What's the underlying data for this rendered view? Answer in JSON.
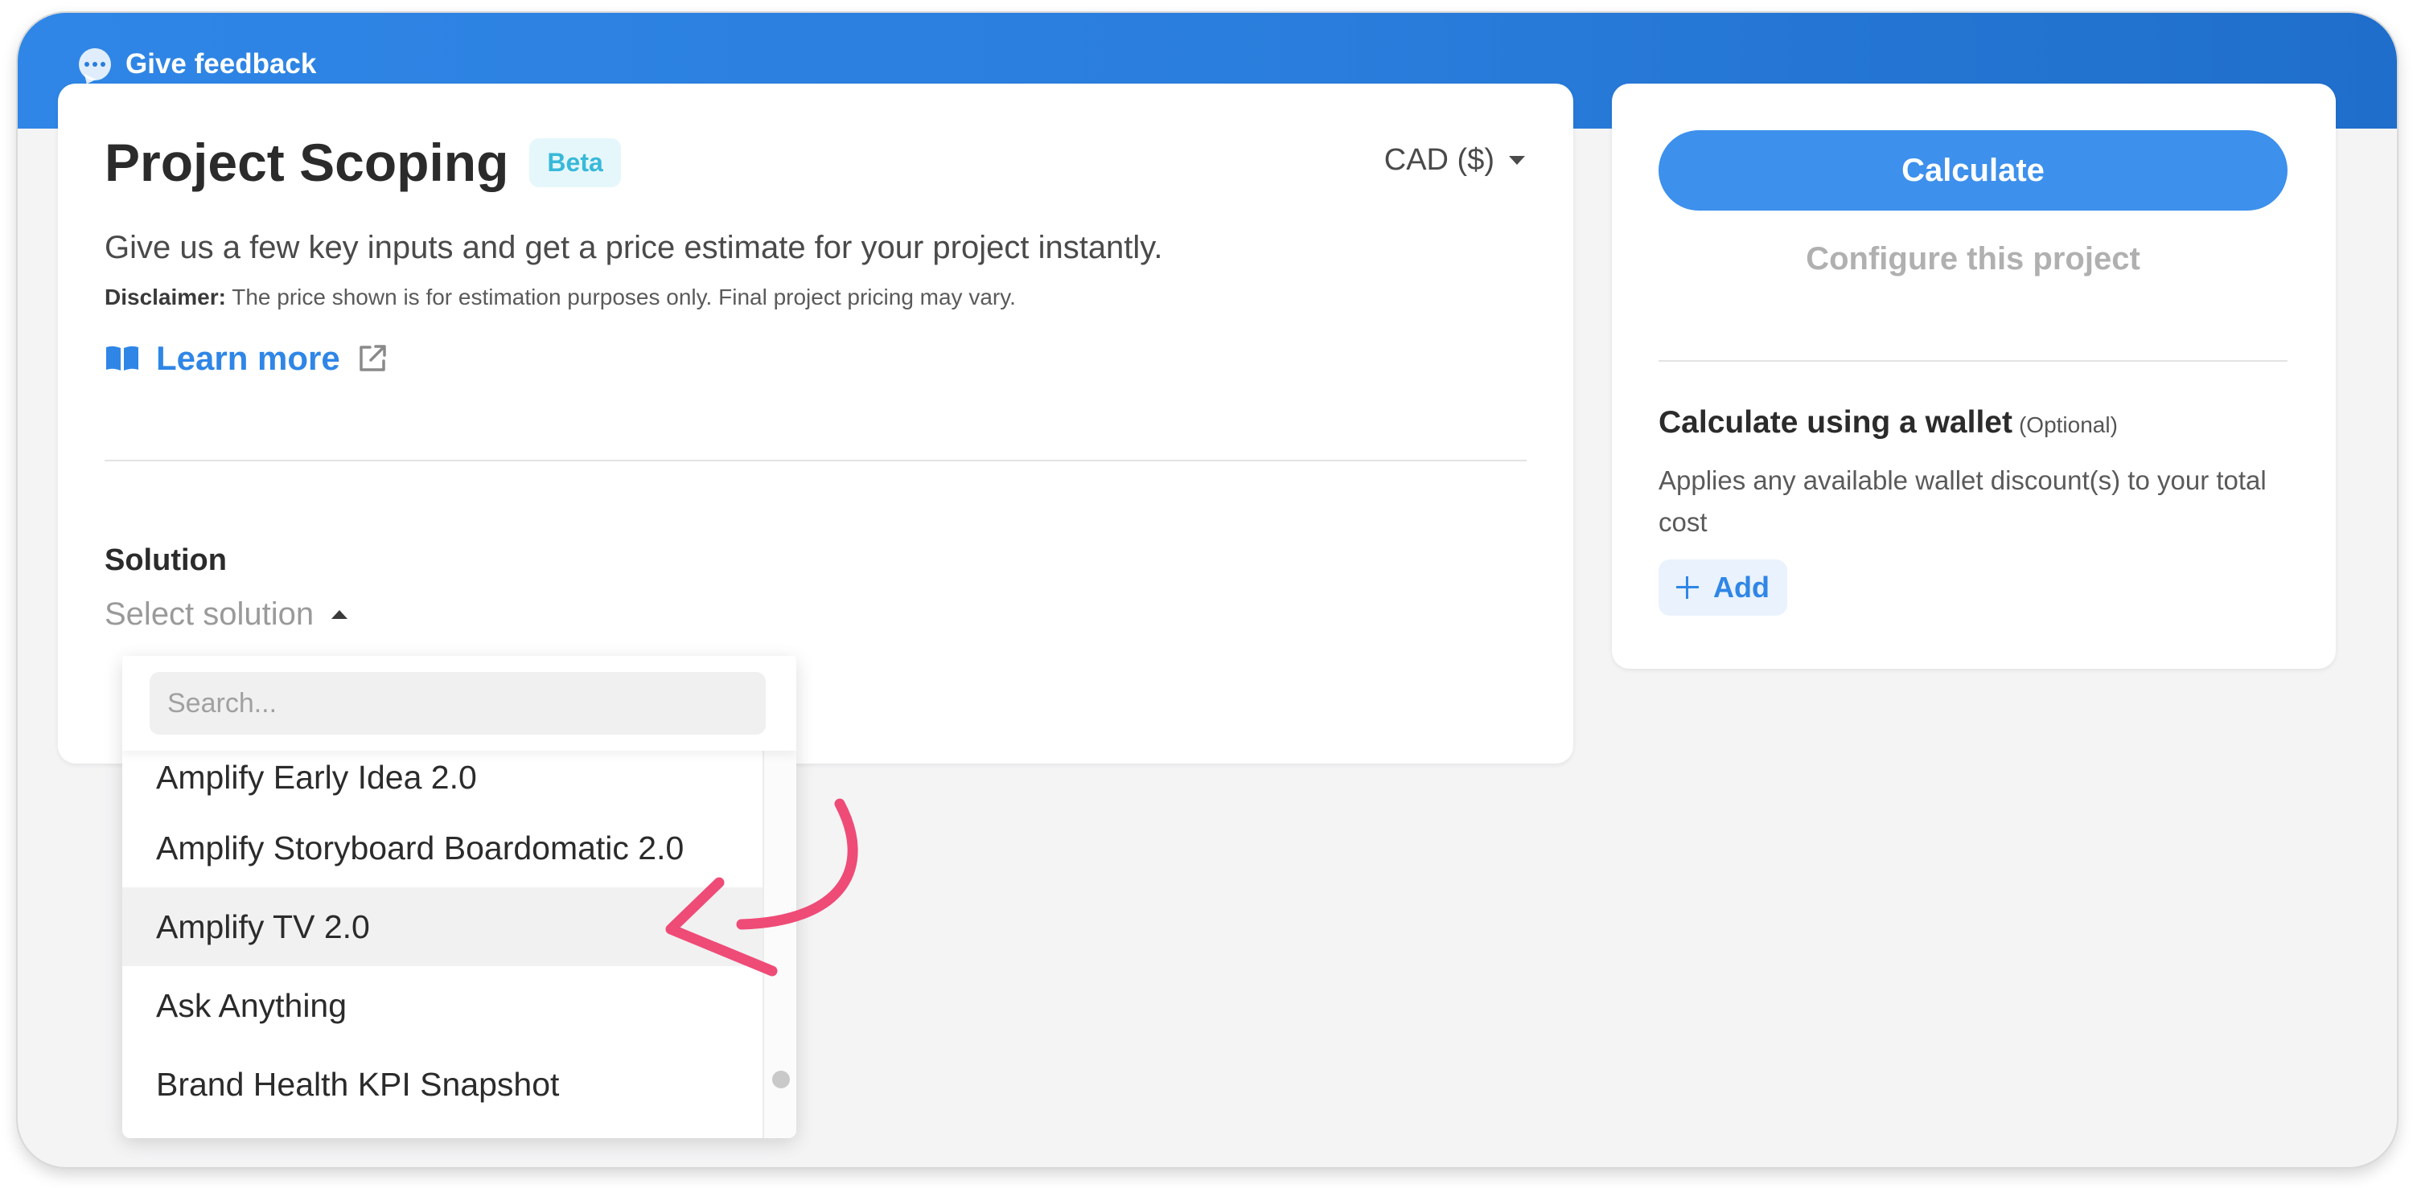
{
  "header": {
    "feedback_label": "Give feedback"
  },
  "main": {
    "title": "Project Scoping",
    "badge": "Beta",
    "currency": "CAD ($)",
    "subtitle": "Give us a few key inputs and get a price estimate for your project instantly.",
    "disclaimer_label": "Disclaimer:",
    "disclaimer_text": " The price shown is for estimation purposes only. Final project pricing may vary.",
    "learn_more": "Learn more",
    "solution_label": "Solution",
    "solution_placeholder": "Select solution"
  },
  "dropdown": {
    "search_placeholder": "Search...",
    "items": [
      {
        "label": "Amplify Early Idea 2.0"
      },
      {
        "label": "Amplify Storyboard Boardomatic 2.0"
      },
      {
        "label": "Amplify TV 2.0"
      },
      {
        "label": "Ask Anything"
      },
      {
        "label": "Brand Health KPI Snapshot"
      }
    ],
    "highlighted_item": "Amplify TV 2.0"
  },
  "side": {
    "calculate_label": "Calculate",
    "configure_label": "Configure this project",
    "wallet_title": "Calculate using a wallet",
    "wallet_optional": "(Optional)",
    "wallet_description": "Applies any available wallet discount(s) to your total cost",
    "add_label": "Add"
  },
  "colors": {
    "header_blue": "#2a7ddc",
    "accent_blue": "#3d90ec",
    "beta_badge_text": "#38b9d9",
    "annotation_arrow": "#ef4b77"
  }
}
